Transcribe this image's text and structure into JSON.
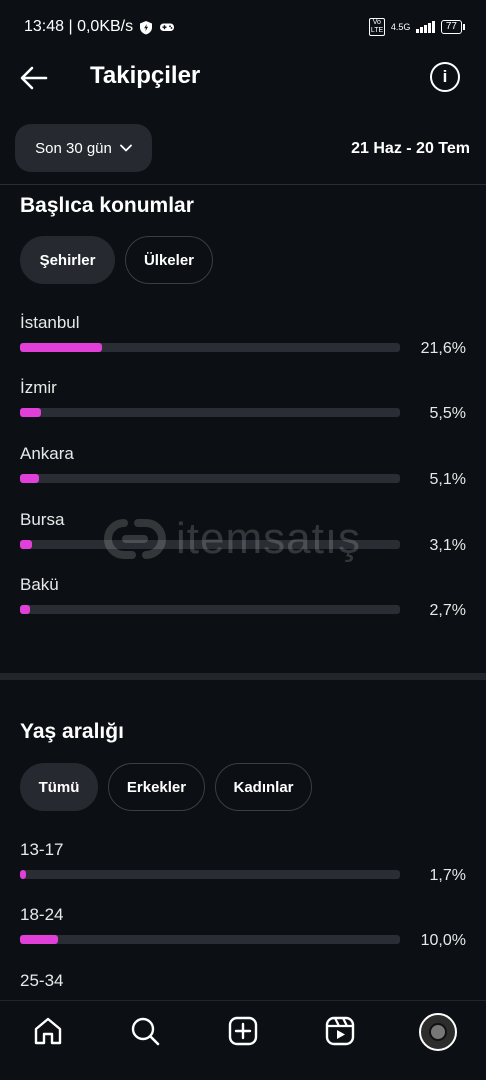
{
  "status_bar": {
    "time_speed": "13:48 | 0,0KB/s",
    "network": "4.5G",
    "volte": "Vo LTE",
    "battery": "77"
  },
  "header": {
    "title": "Takipçiler"
  },
  "filter": {
    "period": "Son 30 gün",
    "date_range": "21 Haz - 20 Tem"
  },
  "top_locations": {
    "title": "Başlıca konumlar",
    "tabs": [
      {
        "label": "Şehirler",
        "active": true
      },
      {
        "label": "Ülkeler",
        "active": false
      }
    ],
    "rows": [
      {
        "label": "İstanbul",
        "value": "21,6%",
        "percent": 21.6
      },
      {
        "label": "İzmir",
        "value": "5,5%",
        "percent": 5.5
      },
      {
        "label": "Ankara",
        "value": "5,1%",
        "percent": 5.1
      },
      {
        "label": "Bursa",
        "value": "3,1%",
        "percent": 3.1
      },
      {
        "label": "Bakü",
        "value": "2,7%",
        "percent": 2.7
      }
    ]
  },
  "age_range": {
    "title": "Yaş aralığı",
    "tabs": [
      {
        "label": "Tümü",
        "active": true
      },
      {
        "label": "Erkekler",
        "active": false
      },
      {
        "label": "Kadınlar",
        "active": false
      }
    ],
    "rows": [
      {
        "label": "13-17",
        "value": "1,7%",
        "percent": 1.7
      },
      {
        "label": "18-24",
        "value": "10,0%",
        "percent": 10.0
      },
      {
        "label": "25-34",
        "value": "",
        "percent": null
      }
    ]
  },
  "watermark": {
    "text": "itemsatış"
  },
  "bottom_nav": {
    "items": [
      "home-icon",
      "search-icon",
      "create-icon",
      "reels-icon",
      "profile-avatar"
    ]
  },
  "colors": {
    "background": "#0c1014",
    "bar_fill": "#e040d8",
    "bar_track": "#2a2d33",
    "chip_active": "#262a30"
  }
}
